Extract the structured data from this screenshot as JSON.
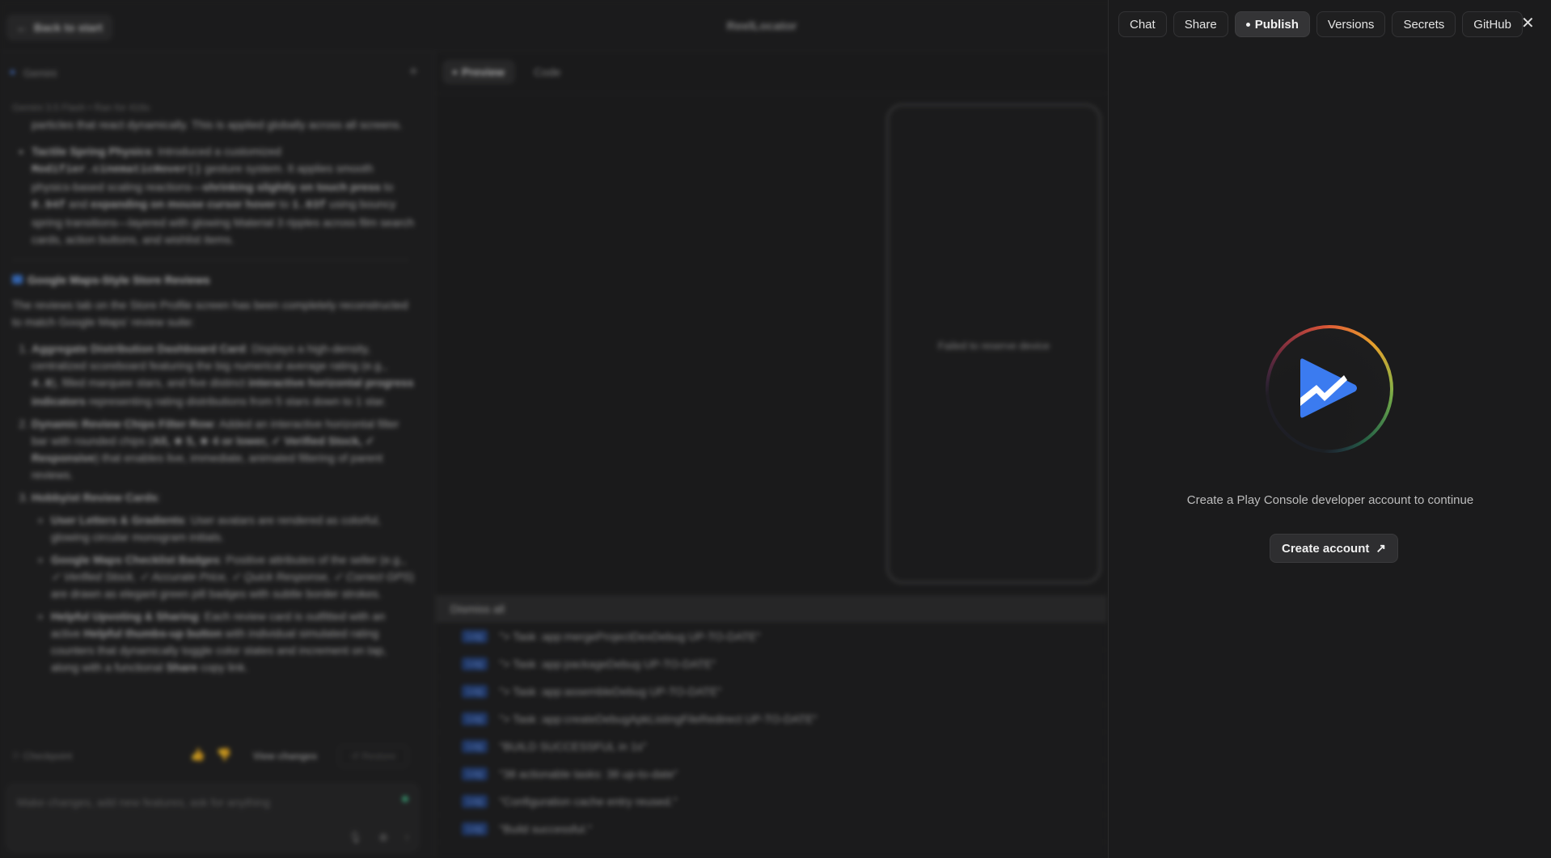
{
  "top_bar": {
    "back_label": "Back to start",
    "back_icon": "arrow-left-icon",
    "app_title": "ReelLocator"
  },
  "chat": {
    "header": "Gemini",
    "model_line": "Gemini 3.5 Flash  •  Ran for 416s",
    "intro_partial": "particles that react dynamically. This is applied globally across all screens.",
    "tactile": {
      "title": "Tactile Spring Physics",
      "t1": ": Introduced a customized ",
      "code1": "Modifier.cinematicHover()",
      "t2": " gesture system. It applies smooth physics-based scaling reactions—",
      "b1": "shrinking slightly on touch press",
      "t3": " to ",
      "code2": "0.94f",
      "t4": " and ",
      "b2": "expanding on mouse cursor hover",
      "t5": " to ",
      "code3": "1.03f",
      "t6": " using bouncy spring transitions—layered with glowing Material 3 ripples across film search cards, action buttons, and wishlist items."
    },
    "section_title": "Google Maps-Style Store Reviews",
    "section_intro": "The reviews tab on the Store Profile screen has been completely reconstructed to match Google Maps' review suite:",
    "item1": {
      "title": "Aggregate Distribution Dashboard Card",
      "t1": ": Displays a high-density, centralized scoreboard featuring the big numerical average rating (e.g., ",
      "code": "4.8",
      "t2": "), filled marquee stars, and five distinct ",
      "b1": "interactive horizontal progress indicators",
      "t3": " representing rating distributions from 5 stars down to 1 star."
    },
    "item2": {
      "title": "Dynamic Review Chips Filter Row",
      "t1": ": Added an interactive horizontal filter bar with rounded chips (",
      "chips": "All, ★ 5, ★ 4 or lower, ✓ Verified Stock, ✓ Responsive",
      "t2": ") that enables live, immediate, animated filtering of parent reviews."
    },
    "item3": {
      "title": "Hobbyist Review Cards",
      "sub1_title": "User Letters & Gradients",
      "sub1_text": ": User avatars are rendered as colorful, glowing circular monogram initials.",
      "sub2_title": "Google Maps Checklist Badges",
      "sub2_t1": ": Positive attributes of the seller (e.g., ",
      "sub2_italic": "✓ Verified Stock, ✓ Accurate Price, ✓ Quick Response, ✓ Correct GPS",
      "sub2_t2": ") are drawn as elegant green pill badges with subtle border strokes.",
      "sub3_title": "Helpful Upvoting & Sharing",
      "sub3_t1": ": Each review card is outfitted with an active ",
      "sub3_b1": "Helpful thumbs-up button",
      "sub3_t2": " with individual simulated rating counters that dynamically toggle color states and increment on tap, along with a functional ",
      "sub3_b2": "Share",
      "sub3_t3": " copy link."
    },
    "checkpoint_label": "Checkpoint",
    "view_changes_label": "View changes",
    "restore_label": "Restore",
    "composer_placeholder": "Make changes, add new features, ask for anything"
  },
  "preview": {
    "tabs": [
      {
        "label": "Preview"
      },
      {
        "label": "Code"
      }
    ],
    "device_message": "Failed to reserve device",
    "dismiss_label": "Dismiss all",
    "log_tag": "Log",
    "logs": [
      "\"> Task :app:mergeProjectDexDebug UP-TO-DATE\"",
      "\"> Task :app:packageDebug UP-TO-DATE\"",
      "\"> Task :app:assembleDebug UP-TO-DATE\"",
      "\"> Task :app:createDebugApkListingFileRedirect UP-TO-DATE\"",
      "\"BUILD SUCCESSFUL in 1s\"",
      "\"38 actionable tasks: 38 up-to-date\"",
      "\"Configuration cache entry reused.\"",
      "\"Build successful.\""
    ]
  },
  "publish_panel": {
    "tabs": [
      {
        "label": "Chat"
      },
      {
        "label": "Share"
      },
      {
        "label": "Publish",
        "active": true
      },
      {
        "label": "Versions"
      },
      {
        "label": "Secrets"
      },
      {
        "label": "GitHub"
      }
    ],
    "close_icon": "close-icon",
    "logo_icon": "play-console-icon",
    "message": "Create a Play Console developer account to continue",
    "create_button_label": "Create account",
    "create_button_icon": "external-link-icon"
  },
  "colors": {
    "background": "#1b1b1c",
    "log_tag_bg": "#213f7a",
    "play_blue": "#3b7bf0",
    "ring_red": "#c63a5a",
    "ring_yellow": "#e5a12c",
    "ring_green": "#2f9e6a"
  }
}
